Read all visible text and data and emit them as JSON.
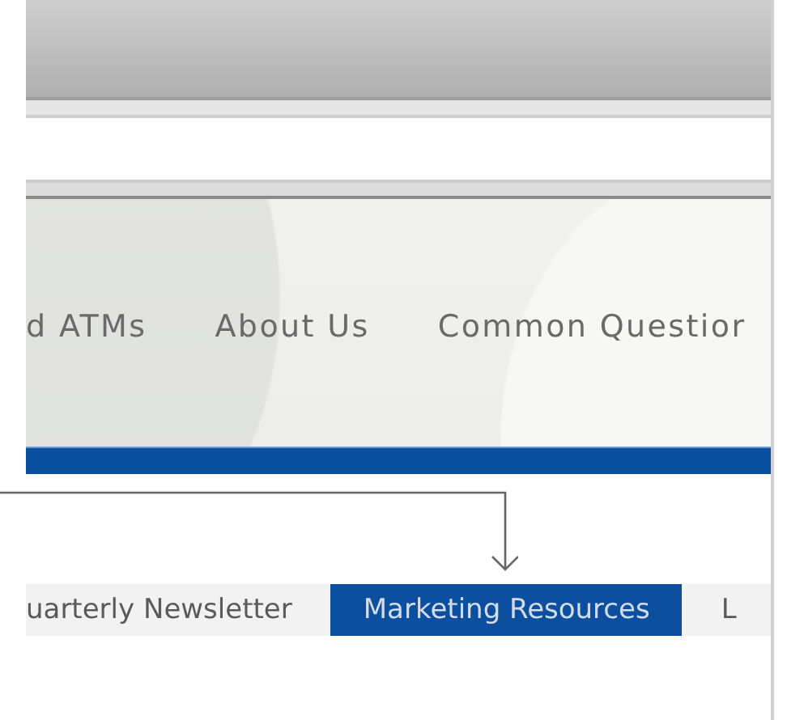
{
  "nav_menu": {
    "items": [
      {
        "label": "d ATMs"
      },
      {
        "label": "About Us"
      },
      {
        "label": "Common Questior"
      }
    ]
  },
  "tabs": [
    {
      "label": "uarterly Newsletter",
      "selected": false
    },
    {
      "label": "Marketing Resources",
      "selected": true
    },
    {
      "label": "L",
      "selected": false
    }
  ],
  "annotation": {
    "kind": "arrow"
  }
}
